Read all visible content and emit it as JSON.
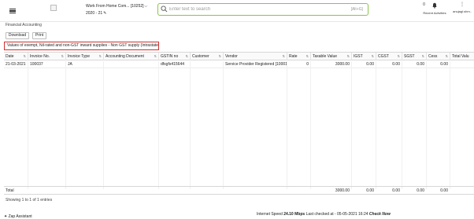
{
  "header": {
    "company": "Work From Home Com... [10252]",
    "year": "2020 - 21",
    "search_placeholder": "Enter text to search",
    "search_shortcut": "[Alt+G]",
    "recent_label": "Recent Activities",
    "recent_badge": "0",
    "user_name": "anujagl.shm.."
  },
  "page": {
    "heading": "Financial Accounting",
    "download_label": "Download",
    "print_label": "Print",
    "report_title": "Values of exempt, Nil-rated and non-GST inward supplies - Non GST supply (Intrastate)"
  },
  "grid": {
    "columns": [
      "Date",
      "Invoice No.",
      "Invoice Type",
      "Accounting Document",
      "GSTIN no",
      "Customer",
      "Vendor",
      "Rate",
      "Taxable Value",
      "IGST",
      "CGST",
      "SGST",
      "Cess",
      "Total Valu"
    ],
    "row": {
      "date": "21-03-2021",
      "invoice_no": "100037",
      "invoice_type": "JA",
      "accounting_document": "",
      "gstin": "dfsgfs415644",
      "customer": "",
      "vendor": "Service Provider Registered [10001]",
      "rate": "0",
      "taxable_value": "3000.00",
      "igst": "0.00",
      "cgst": "0.00",
      "sgst": "0.00",
      "cess": "0.00"
    },
    "totals": {
      "label": "Total",
      "taxable_value": "3000.00",
      "igst": "0.00",
      "cgst": "0.00",
      "sgst": "0.00",
      "cess": "0.00"
    },
    "entries": "Showing 1 to 1 of 1 entries"
  },
  "footer": {
    "assistant": "Zap Assistant",
    "speed_prefix": "Internet Speed",
    "speed_value": "24.10 Mbps",
    "last_checked": "Last checked at - 05-05-2021 16:24",
    "check_now": "Check Now"
  },
  "colors": {
    "search_border": "#8bc34a",
    "title_border": "#d32f2f",
    "badge": "#e53935"
  }
}
